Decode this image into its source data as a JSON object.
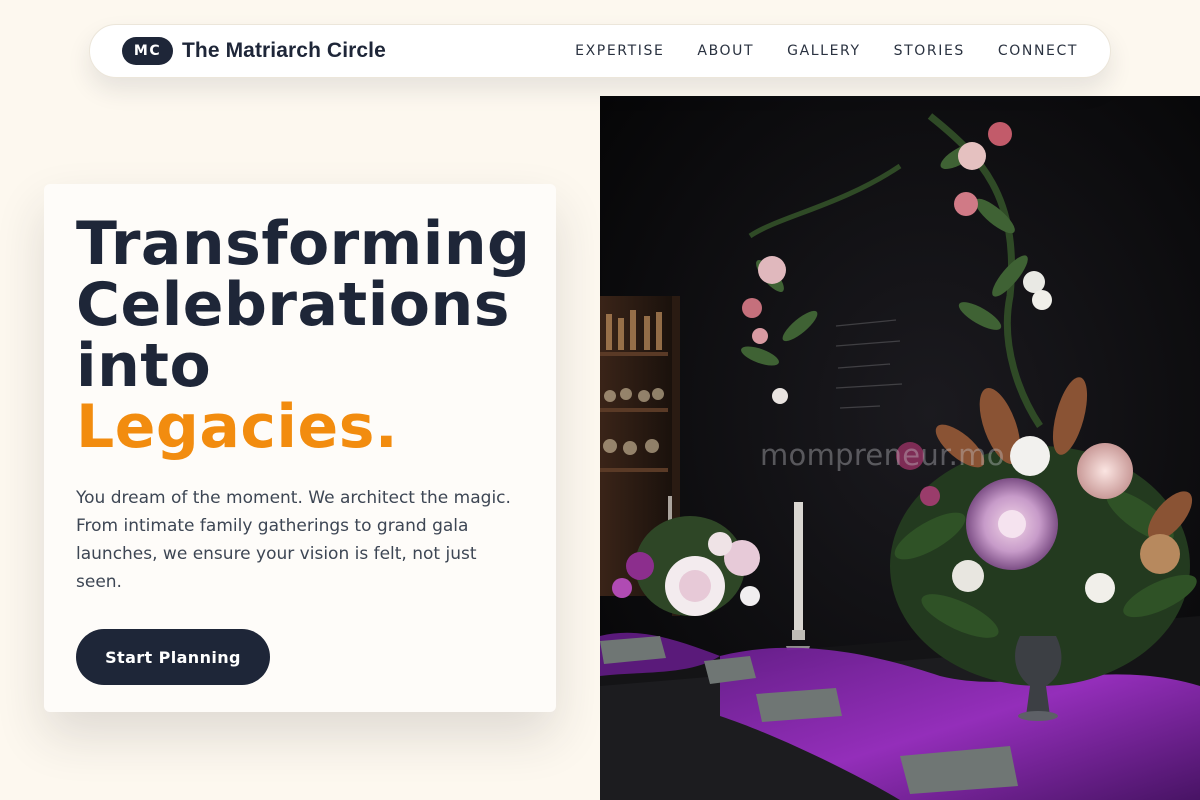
{
  "brand": {
    "logo_text": "MC",
    "name": "The Matriarch Circle"
  },
  "nav": {
    "links": [
      "EXPERTISE",
      "ABOUT",
      "GALLERY",
      "STORIES",
      "CONNECT"
    ]
  },
  "hero": {
    "headline_lines": [
      "Transforming",
      "Celebrations",
      "into"
    ],
    "headline_accent": "Legacies.",
    "description": "You dream of the moment. We architect the magic. From intimate family gatherings to grand gala launches, we ensure your vision is felt, not just seen.",
    "cta_label": "Start Planning",
    "image_watermark": "mompreneur.mo"
  },
  "colors": {
    "background": "#fdf8ef",
    "navy": "#1e2638",
    "accent_orange": "#f28c0f",
    "card": "#fefcf9"
  },
  "icons": {
    "hero_image": "event-table-floral-photo"
  }
}
